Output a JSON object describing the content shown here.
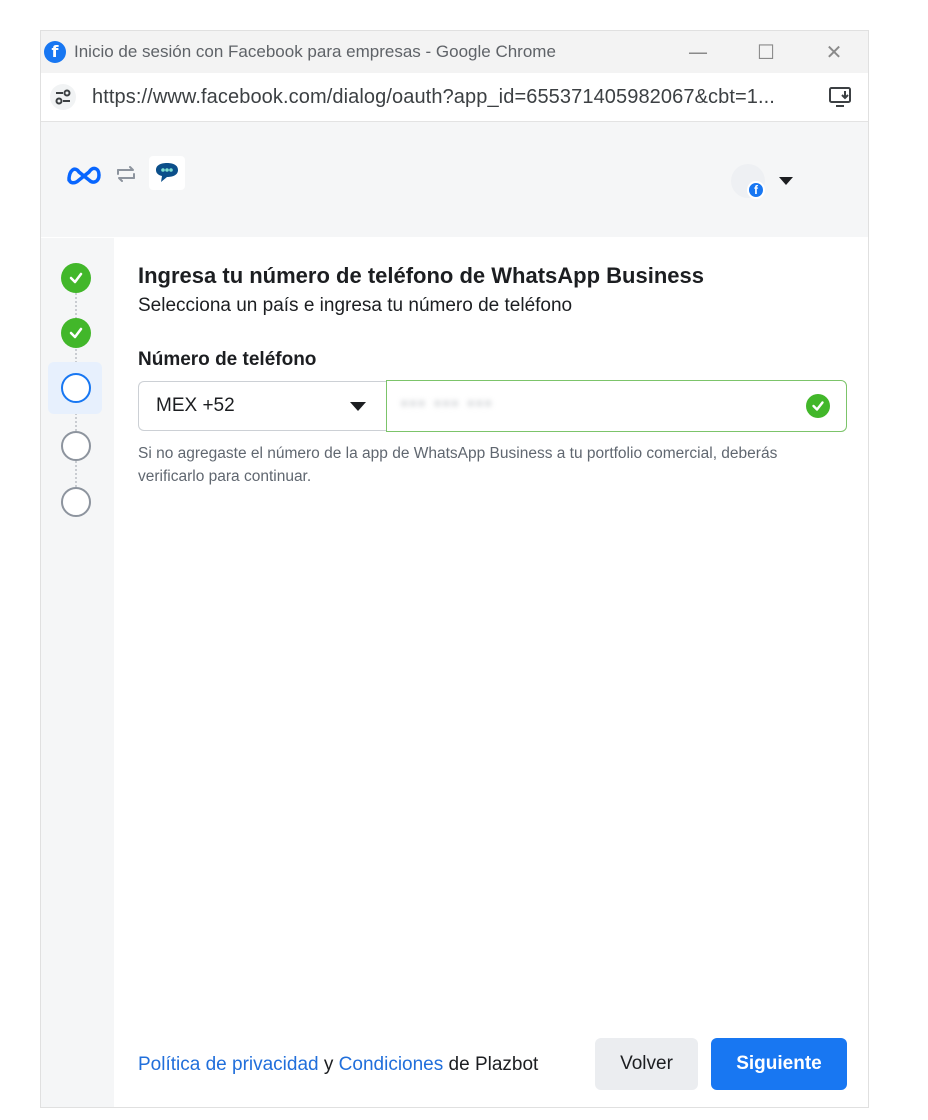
{
  "window": {
    "title": "Inicio de sesión con Facebook para empresas - Google Chrome",
    "minimize_glyph": "—",
    "maximize_glyph": "☐",
    "close_glyph": "✕"
  },
  "browser": {
    "url": "https://www.facebook.com/dialog/oauth?app_id=655371405982067&cbt=1..."
  },
  "icons": {
    "favicon": "facebook-icon",
    "site_info": "tune-icon",
    "install": "install-app-icon",
    "brand": "meta-icon",
    "sync": "sync-arrows-icon",
    "app": "chat-bubble-icon",
    "account_badge_letter": "f"
  },
  "steps": [
    {
      "status": "done"
    },
    {
      "status": "done"
    },
    {
      "status": "current"
    },
    {
      "status": "pending"
    },
    {
      "status": "pending"
    }
  ],
  "form": {
    "heading": "Ingresa tu número de teléfono de WhatsApp Business",
    "subheading": "Selecciona un país e ingresa tu número de teléfono",
    "phone_label": "Número de teléfono",
    "country_value": "MEX +52",
    "phone_value": "••• ••• •••",
    "help_text": "Si no agregaste el número de la app de WhatsApp Business a tu portfolio comercial, deberás verificarlo para continuar."
  },
  "footer": {
    "privacy_link": "Política de privacidad",
    "conjunction": " y ",
    "terms_link": "Condiciones",
    "suffix": " de Plazbot",
    "back_label": "Volver",
    "next_label": "Siguiente"
  },
  "colors": {
    "accent": "#1877f2",
    "success": "#42b72a",
    "link": "#216fdb"
  }
}
